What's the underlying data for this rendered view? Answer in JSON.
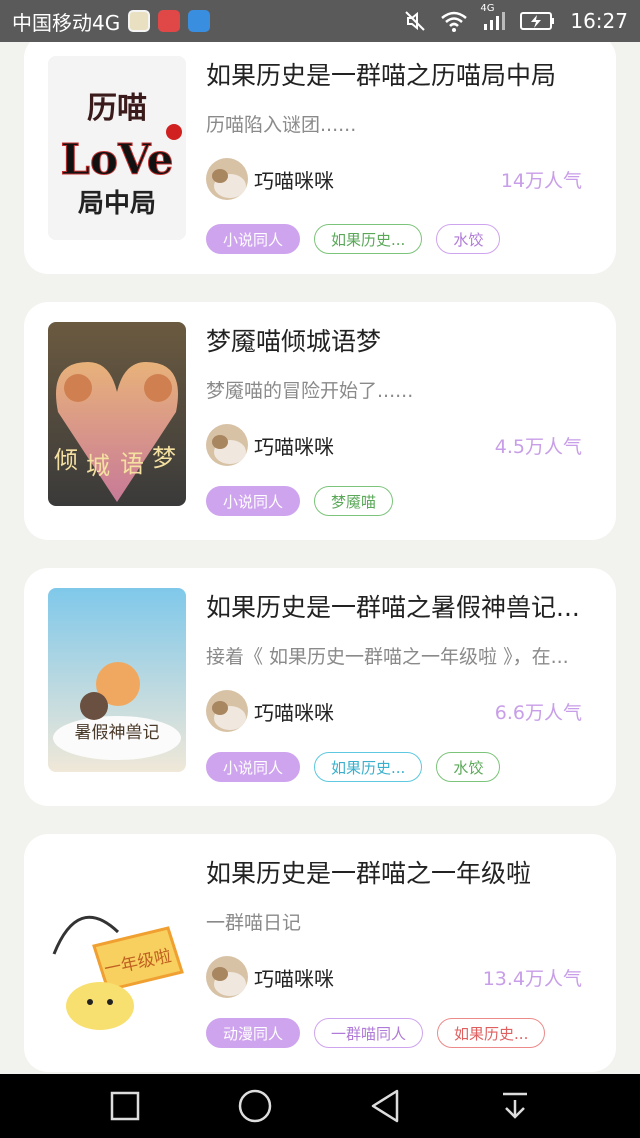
{
  "status_bar": {
    "carrier": "中国移动4G",
    "network": "4G",
    "time": "16:27",
    "app_icons": [
      "colorful-app-icon",
      "red-app-icon",
      "blue-app-icon"
    ],
    "right_icons": [
      "mute-icon",
      "wifi-icon",
      "signal-icon",
      "battery-charging-icon"
    ]
  },
  "stories": [
    {
      "title": "如果历史是一群喵之历喵局中局",
      "description": "历喵陷入谜团......",
      "cover_text": [
        "历喵",
        "LoVe",
        "局中局"
      ],
      "author": "巧喵咪咪",
      "popularity": "14万人气",
      "tags": [
        {
          "label": "小说同人",
          "style": "filled",
          "color": "#cfa4ee"
        },
        {
          "label": "如果历史...",
          "style": "outline",
          "color": "#7cc47a"
        },
        {
          "label": "水饺",
          "style": "outline",
          "color": "#cfa4ee"
        }
      ]
    },
    {
      "title": "梦魇喵倾城语梦",
      "description": "梦魇喵的冒险开始了......",
      "cover_text": [
        "倾",
        "城",
        "语",
        "梦"
      ],
      "author": "巧喵咪咪",
      "popularity": "4.5万人气",
      "tags": [
        {
          "label": "小说同人",
          "style": "filled",
          "color": "#cfa4ee"
        },
        {
          "label": "梦魇喵",
          "style": "outline",
          "color": "#7cc47a"
        }
      ]
    },
    {
      "title": "如果历史是一群喵之暑假神兽记...",
      "description": "接着《 如果历史一群喵之一年级啦 》，在...",
      "cover_text": [
        "暑假神兽记"
      ],
      "author": "巧喵咪咪",
      "popularity": "6.6万人气",
      "tags": [
        {
          "label": "小说同人",
          "style": "filled",
          "color": "#cfa4ee"
        },
        {
          "label": "如果历史...",
          "style": "outline",
          "color": "#5dc8e0"
        },
        {
          "label": "水饺",
          "style": "outline",
          "color": "#7cc47a"
        }
      ]
    },
    {
      "title": "如果历史是一群喵之一年级啦",
      "description": "一群喵日记",
      "cover_text": [
        "一年级啦"
      ],
      "author": "巧喵咪咪",
      "popularity": "13.4万人气",
      "tags": [
        {
          "label": "动漫同人",
          "style": "filled",
          "color": "#cfa4ee"
        },
        {
          "label": "一群喵同人",
          "style": "outline",
          "color": "#cfa4ee"
        },
        {
          "label": "如果历史...",
          "style": "outline",
          "color": "#ec8a8a"
        }
      ]
    }
  ],
  "nav_bar": {
    "buttons": [
      "recent-apps-square-icon",
      "home-circle-icon",
      "back-triangle-icon",
      "pull-down-icon"
    ]
  }
}
